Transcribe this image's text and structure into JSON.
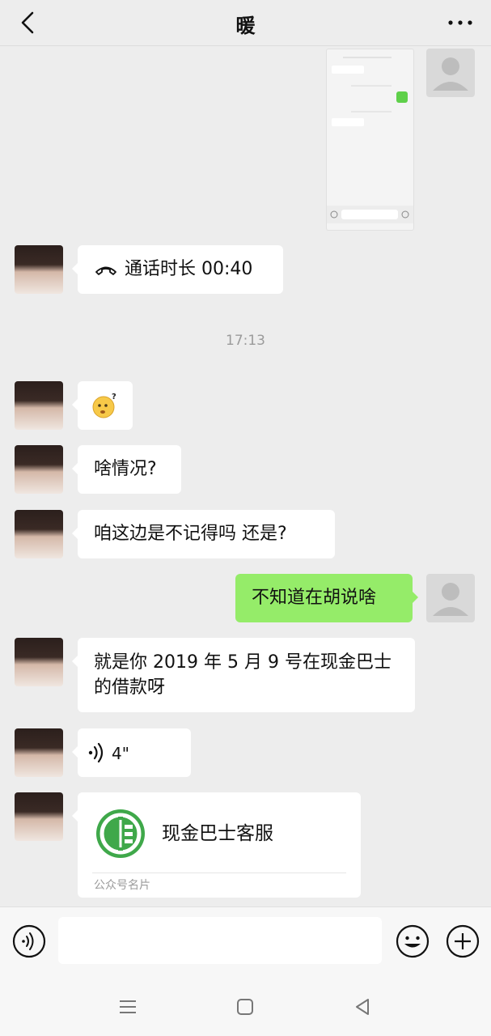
{
  "header": {
    "title": "暖"
  },
  "messages": {
    "call_text": "通话时长 00:40",
    "time_1": "17:13",
    "msg_1": "啥情况?",
    "msg_2": "咱这边是不记得吗 还是?",
    "msg_3_self": "不知道在胡说啥",
    "msg_4": "就是你 2019 年 5 月 9 号在现金巴士的借款呀",
    "voice_duration": "4\"",
    "card_name": "现金巴士客服",
    "card_type": "公众号名片"
  },
  "colors": {
    "self_bubble": "#95ec69",
    "background": "#ededed",
    "card_logo": "#3fa84a"
  },
  "icons": {
    "back": "chevron-left-icon",
    "more": "more-dots-icon",
    "call": "phone-hangup-icon",
    "voice": "voice-wave-icon",
    "emoji": "smiley-icon",
    "plus": "plus-circle-icon"
  }
}
